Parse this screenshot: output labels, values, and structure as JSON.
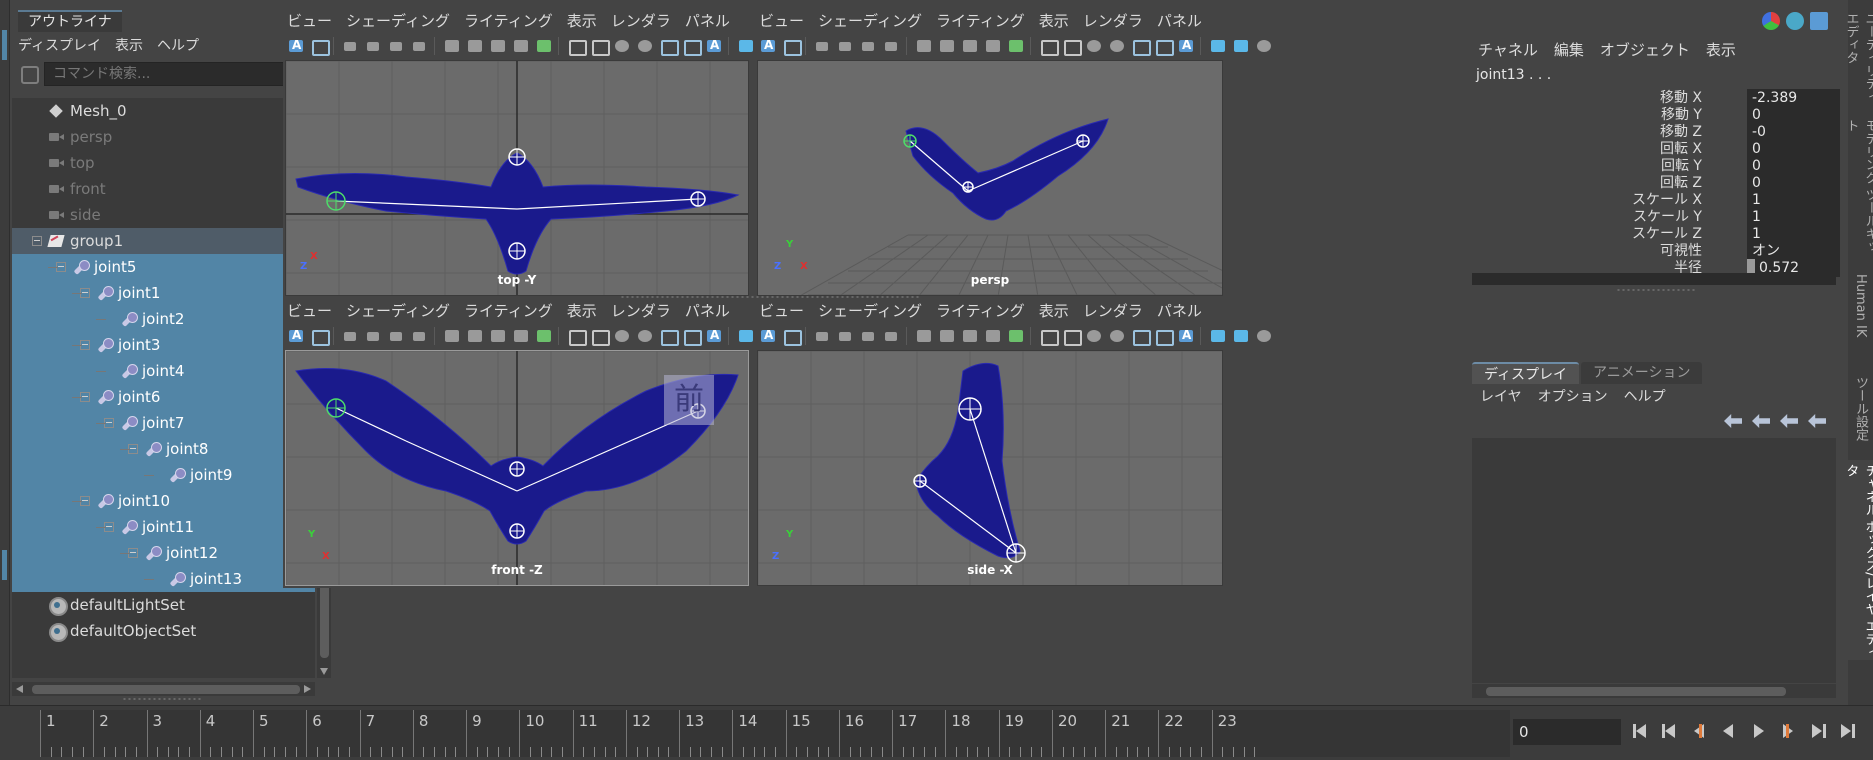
{
  "outliner": {
    "tab": "アウトライナ",
    "menu": [
      "ディスプレイ",
      "表示",
      "ヘルプ"
    ],
    "search_placeholder": "コマンド検索..."
  },
  "tree": [
    {
      "label": "Mesh_0",
      "icon": "mesh",
      "depth": 0,
      "state": "normal"
    },
    {
      "label": "persp",
      "icon": "cam",
      "depth": 0,
      "state": "dim"
    },
    {
      "label": "top",
      "icon": "cam",
      "depth": 0,
      "state": "dim"
    },
    {
      "label": "front",
      "icon": "cam",
      "depth": 0,
      "state": "dim"
    },
    {
      "label": "side",
      "icon": "cam",
      "depth": 0,
      "state": "dim"
    },
    {
      "label": "group1",
      "icon": "grp",
      "depth": 0,
      "state": "grp",
      "expanded": true
    },
    {
      "label": "joint5",
      "icon": "joint",
      "depth": 1,
      "state": "sel",
      "expanded": true
    },
    {
      "label": "joint1",
      "icon": "joint",
      "depth": 2,
      "state": "sel",
      "expanded": true
    },
    {
      "label": "joint2",
      "icon": "joint",
      "depth": 3,
      "state": "sel"
    },
    {
      "label": "joint3",
      "icon": "joint",
      "depth": 2,
      "state": "sel",
      "expanded": true
    },
    {
      "label": "joint4",
      "icon": "joint",
      "depth": 3,
      "state": "sel"
    },
    {
      "label": "joint6",
      "icon": "joint",
      "depth": 2,
      "state": "sel",
      "expanded": true
    },
    {
      "label": "joint7",
      "icon": "joint",
      "depth": 3,
      "state": "sel",
      "expanded": true
    },
    {
      "label": "joint8",
      "icon": "joint",
      "depth": 4,
      "state": "sel",
      "expanded": true
    },
    {
      "label": "joint9",
      "icon": "joint",
      "depth": 5,
      "state": "sel"
    },
    {
      "label": "joint10",
      "icon": "joint",
      "depth": 2,
      "state": "sel",
      "expanded": true
    },
    {
      "label": "joint11",
      "icon": "joint",
      "depth": 3,
      "state": "sel",
      "expanded": true
    },
    {
      "label": "joint12",
      "icon": "joint",
      "depth": 4,
      "state": "sel",
      "expanded": true
    },
    {
      "label": "joint13",
      "icon": "joint",
      "depth": 5,
      "state": "sel"
    },
    {
      "label": "defaultLightSet",
      "icon": "set",
      "depth": 0,
      "state": "normal"
    },
    {
      "label": "defaultObjectSet",
      "icon": "set",
      "depth": 0,
      "state": "normal"
    }
  ],
  "viewport_menu": [
    "ビュー",
    "シェーディング",
    "ライティング",
    "表示",
    "レンダラ",
    "パネル"
  ],
  "viewports": {
    "top": {
      "label": "top -Y",
      "axis_v": "Z",
      "axis_h": "X"
    },
    "persp": {
      "label": "persp",
      "axis_v": "Y",
      "axis_h": "X",
      "axis_z": "Z"
    },
    "front": {
      "label": "front -Z",
      "axis_v": "Y",
      "axis_h": "X"
    },
    "side": {
      "label": "side -X",
      "axis_v": "Y",
      "axis_h": "Z"
    }
  },
  "front_overlay": "前",
  "channel": {
    "menu": [
      "チャネル",
      "編集",
      "オブジェクト",
      "表示"
    ],
    "node": "joint13 . . .",
    "attrs": [
      {
        "name": "移動 X",
        "value": "-2.389"
      },
      {
        "name": "移動 Y",
        "value": "0"
      },
      {
        "name": "移動 Z",
        "value": "-0"
      },
      {
        "name": "回転 X",
        "value": "0"
      },
      {
        "name": "回転 Y",
        "value": "0"
      },
      {
        "name": "回転 Z",
        "value": "0"
      },
      {
        "name": "スケール X",
        "value": "1"
      },
      {
        "name": "スケール Y",
        "value": "1"
      },
      {
        "name": "スケール Z",
        "value": "1"
      },
      {
        "name": "可視性",
        "value": "オン"
      },
      {
        "name": "半径",
        "value": "0.572"
      }
    ]
  },
  "layers": {
    "tabs": [
      "ディスプレイ",
      "アニメーション"
    ],
    "menu": [
      "レイヤ",
      "オプション",
      "ヘルプ"
    ]
  },
  "vtabs": [
    "ユーティリティ エディタ",
    "モデリング ツールキット",
    "Human IK",
    "ツール設定",
    "チャネル ボックス/レイヤ エディタ"
  ],
  "timeline": {
    "ticks": [
      "1",
      "2",
      "3",
      "4",
      "5",
      "6",
      "7",
      "8",
      "9",
      "10",
      "11",
      "12",
      "13",
      "14",
      "15",
      "16",
      "17",
      "18",
      "19",
      "20",
      "21",
      "22",
      "23"
    ],
    "current_frame": "0"
  },
  "colors": {
    "selection": "#5285a6",
    "wire": "#1a1a8c",
    "joint": "#ffffff",
    "accent": "#5b9bd5"
  }
}
